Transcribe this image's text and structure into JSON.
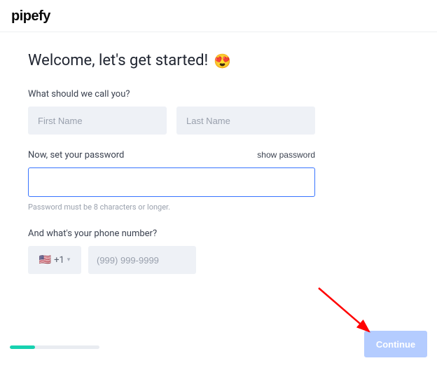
{
  "brand": {
    "logo_text": "pipefy"
  },
  "heading": {
    "text": "Welcome, let's get started!",
    "emoji": "😍"
  },
  "name_section": {
    "label": "What should we call you?",
    "first_placeholder": "First Name",
    "last_placeholder": "Last Name",
    "first_value": "",
    "last_value": ""
  },
  "password_section": {
    "label": "Now, set your password",
    "show_label": "show password",
    "hint": "Password must be 8 characters or longer.",
    "value": ""
  },
  "phone_section": {
    "label": "And what's your phone number?",
    "country_flag": "🇺🇸",
    "dial_code": "+1",
    "placeholder": "(999) 999-9999",
    "value": ""
  },
  "footer": {
    "continue_label": "Continue",
    "progress_percent": 28
  },
  "annotation": {
    "arrow_color": "#ff0000"
  }
}
